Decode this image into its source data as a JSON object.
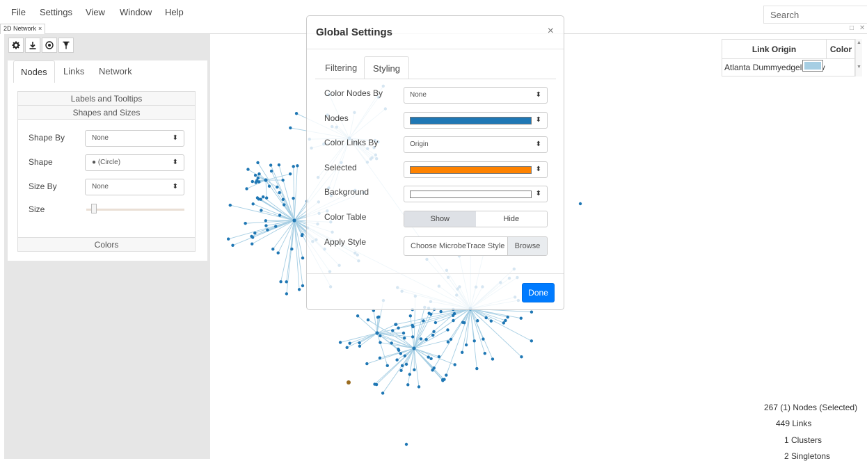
{
  "menu": {
    "items": [
      "File",
      "Settings",
      "View",
      "Window",
      "Help"
    ],
    "search_placeholder": "Search"
  },
  "tabs": {
    "active_label": "2D Network",
    "close_glyph": "×"
  },
  "toolbar": {
    "icons": [
      "gear-icon",
      "download-icon",
      "target-icon",
      "pin-icon"
    ]
  },
  "left_panel": {
    "tabs": [
      "Nodes",
      "Links",
      "Network"
    ],
    "active_tab": "Nodes",
    "sections": {
      "labels": "Labels and Tooltips",
      "shapes": "Shapes and Sizes",
      "colors": "Colors"
    },
    "fields": {
      "shape_by_label": "Shape By",
      "shape_by_value": "None",
      "shape_label": "Shape",
      "shape_value": "● (Circle)",
      "size_by_label": "Size By",
      "size_by_value": "None",
      "size_label": "Size",
      "size_value": 0.05
    }
  },
  "modal": {
    "title": "Global Settings",
    "close": "×",
    "tabs": [
      "Filtering",
      "Styling"
    ],
    "active_tab": "Styling",
    "fields": {
      "color_nodes_by_label": "Color Nodes By",
      "color_nodes_by_value": "None",
      "nodes_label": "Nodes",
      "nodes_color": "#1f77b4",
      "color_links_by_label": "Color Links By",
      "color_links_by_value": "Origin",
      "selected_label": "Selected",
      "selected_color": "#ff8300",
      "background_label": "Background",
      "background_color": "#ffffff",
      "color_table_label": "Color Table",
      "color_table_show": "Show",
      "color_table_hide": "Hide",
      "color_table_selected": "Show",
      "apply_style_label": "Apply Style",
      "apply_style_placeholder": "Choose MicrobeTrace Style",
      "browse": "Browse"
    },
    "done": "Done"
  },
  "color_table": {
    "headers": [
      "Link Origin",
      "Color"
    ],
    "rows": [
      {
        "origin": "Atlanta Dummyedgelist.csv",
        "color": "#a6cee3"
      }
    ]
  },
  "stats": {
    "nodes": "267 (1) Nodes (Selected)",
    "links": "449 Links",
    "clusters": "1 Clusters",
    "singletons": "2 Singletons"
  },
  "colors": {
    "node": "#1f77b4",
    "link": "#a6cee3",
    "selected_node": "#9a6b1f",
    "accent": "#007bff",
    "panel_bg": "#e6e6e6"
  }
}
